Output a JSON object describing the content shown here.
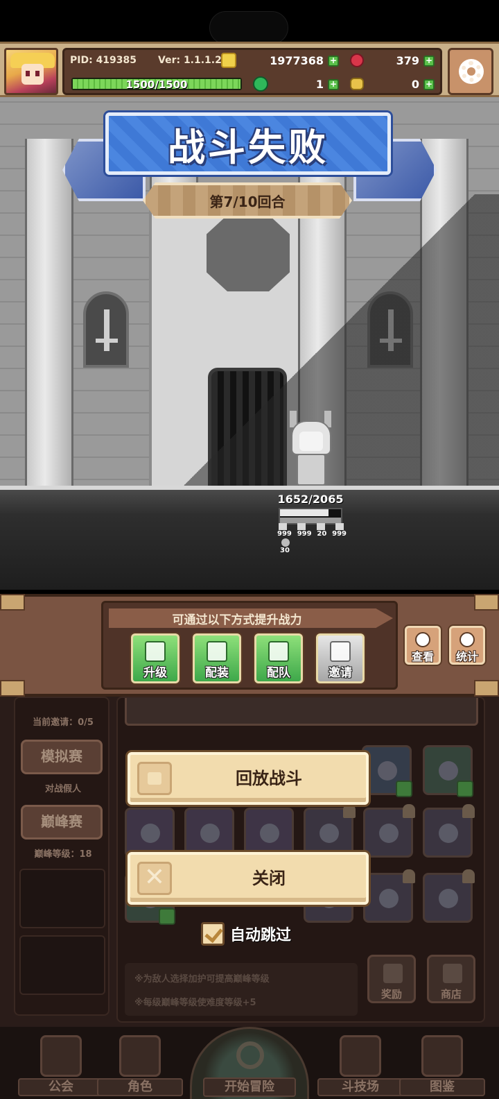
{
  "status_bar": {
    "pid": "PID: 419385",
    "version": "Ver: 1.1.1.2",
    "gold": "1977368",
    "gems": "379",
    "stamina": "1500/1500",
    "stamina_fraction": 1.0,
    "clover": "1",
    "bone": "0"
  },
  "battle": {
    "result_title": "战斗失败",
    "round_text": "第7/10回合",
    "hero_hp": "1652/2065",
    "hero_hp_fraction": 0.8,
    "stats": [
      "999",
      "999",
      "20",
      "999"
    ],
    "extra_stat": "30"
  },
  "powerup": {
    "tip": "可通过以下方式提升战力",
    "buttons": [
      "升级",
      "配装",
      "配队",
      "邀请"
    ],
    "view_label": "查看",
    "stats_label": "统计"
  },
  "underlay": {
    "invite_status": "当前邀请：0/5",
    "sim_tab": "模拟赛",
    "sim_sub": "对战假人",
    "peak_tab": "巅峰赛",
    "peak_sub": "巅峰等级：18",
    "note1": "※为敌人选择加护可提高巅峰等级",
    "note2": "※每级巅峰等级使难度等级+5",
    "reward_label": "奖励",
    "shop_label": "商店"
  },
  "nav": {
    "guild": "公会",
    "character": "角色",
    "adventure": "开始冒险",
    "arena": "斗技场",
    "codex": "图鉴"
  },
  "dialog": {
    "replay": "回放战斗",
    "close": "关闭",
    "auto_skip": "自动跳过"
  }
}
